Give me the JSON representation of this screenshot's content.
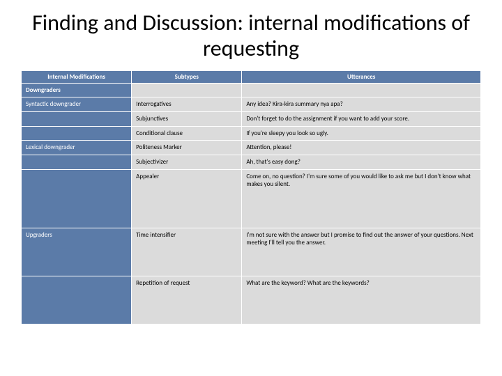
{
  "title": "Finding and Discussion: internal modifications of requesting",
  "headers": {
    "col1": "Internal Modifications",
    "col2": "Subtypes",
    "col3": "Utterances"
  },
  "cat_head": "Downgraders",
  "cat1": "Syntactic downgrader",
  "cat2": "Lexical downgrader",
  "cat3": "Upgraders",
  "rows": {
    "r1s": "Interrogatives",
    "r1u": "Any idea? Kira-kira summary nya apa?",
    "r2s": "Subjunctives",
    "r2u": "Don't forget to do the assignment if you want to add your score.",
    "r3s": "Conditional clause",
    "r3u": "If you're sleepy you look so ugly.",
    "r4s": "Politeness Marker",
    "r4u": "Attention, please!",
    "r5s": "Subjectivizer",
    "r5u": "Ah, that's easy dong?",
    "r6s": "Appealer",
    "r6u": "Come on, no question? I'm sure some of you would like to ask me but I don't know what makes you silent.",
    "r7s": "Time intensifier",
    "r7u": "I'm not sure with the answer but I promise to find out the answer of your questions. Next meeting I'll tell you the answer.",
    "r8s": "Repetition of request",
    "r8u": "What are the keyword? What are the keywords?"
  }
}
